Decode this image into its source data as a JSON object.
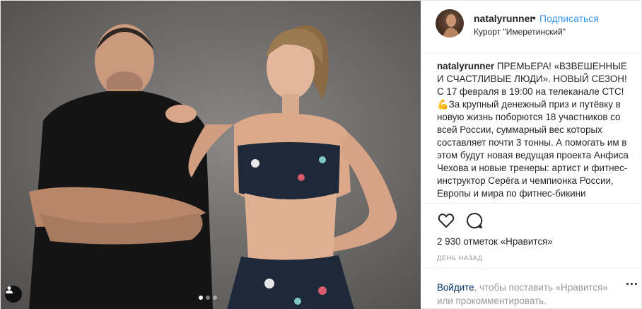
{
  "post": {
    "author": {
      "username": "natalyrunner",
      "separator": "•",
      "follow_label": "Подписаться",
      "location": "Курорт \"Имеретинский\""
    },
    "caption": {
      "username": "natalyrunner",
      "text": "ПРЕМЬЕРА! «ВЗВЕШЕННЫЕ И СЧАСТЛИВЫЕ ЛЮДИ». НОВЫЙ СЕЗОН! С 17 февраля в 19:00 на телеканале СТС! 💪За крупный денежный приз и путёвку в новую жизнь поборются 18 участников со всей России, суммарный вес которых составляет почти 3 тонны. А помогать им в этом будут новая ведущая проекта Анфиса Чехова и новые тренеры: артист и фитнес-инструктор Серёга и чемпионка России, Европы и мира по фитнес-бикини"
    },
    "likes_label": "2 930 отметок «Нравится»",
    "time_label": "ДЕНЬ НАЗАД",
    "login_prompt": {
      "link": "Войдите",
      "text": ", чтобы поставить «Нравится» или прокомментировать."
    },
    "carousel": {
      "count": 3,
      "active": 1
    },
    "icons": [
      "heart-icon",
      "comment-icon",
      "more-icon",
      "user-tag-icon"
    ],
    "colors": {
      "link": "#3897f0",
      "login_link": "#003569",
      "muted": "#999999",
      "text": "#262626"
    }
  }
}
